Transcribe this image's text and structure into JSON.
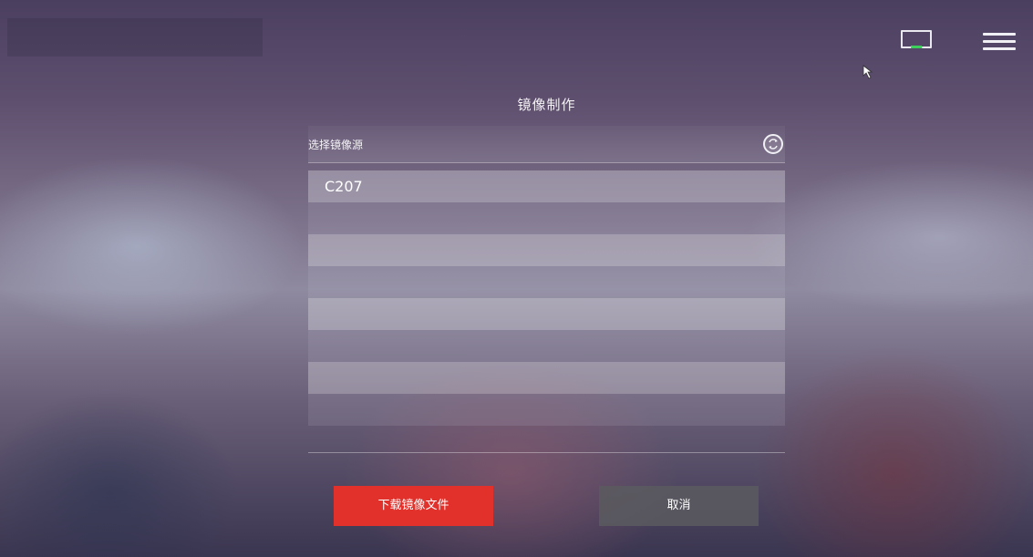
{
  "dialog": {
    "title": "镜像制作",
    "source_label": "选择镜像源",
    "list_items": [
      "C207",
      "",
      "",
      "",
      "",
      "",
      "",
      ""
    ],
    "buttons": {
      "download": "下载镜像文件",
      "cancel": "取消"
    }
  },
  "icons": {
    "screen": "monitor-icon",
    "menu": "hamburger-menu-icon",
    "refresh": "refresh-icon",
    "cursor": "mouse-cursor-icon"
  },
  "colors": {
    "primary_button": "#e2302a",
    "secondary_button": "#5a5a5f",
    "status_indicator": "#3bd05a"
  }
}
